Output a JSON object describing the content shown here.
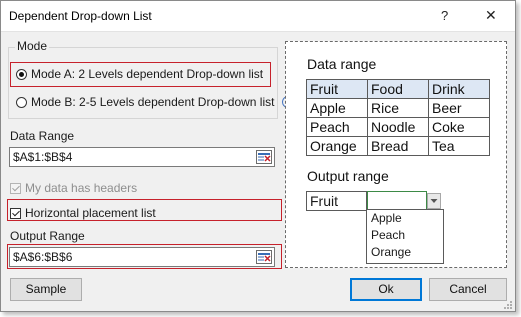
{
  "window": {
    "title": "Dependent Drop-down List",
    "help_glyph": "?",
    "close_glyph": "✕"
  },
  "mode": {
    "group_label": "Mode",
    "option_a": "Mode A: 2 Levels dependent Drop-down list",
    "option_b": "Mode B: 2-5 Levels dependent Drop-down list",
    "selected": "option_a",
    "info_glyph": "i"
  },
  "data_range": {
    "label": "Data Range",
    "value": "$A$1:$B$4"
  },
  "headers": {
    "label": "My data has headers",
    "checked": true,
    "enabled": false
  },
  "horizontal": {
    "label": "Horizontal placement list",
    "checked": true
  },
  "output_range": {
    "label": "Output Range",
    "value": "$A$6:$B$6"
  },
  "preview": {
    "data_heading": "Data range",
    "table": [
      [
        "Fruit",
        "Food",
        "Drink"
      ],
      [
        "Apple",
        "Rice",
        "Beer"
      ],
      [
        "Peach",
        "Noodle",
        "Coke"
      ],
      [
        "Orange",
        "Bread",
        "Tea"
      ]
    ],
    "output_heading": "Output range",
    "output_cell": "Fruit",
    "dropdown_options": [
      "Apple",
      "Peach",
      "Orange"
    ]
  },
  "buttons": {
    "sample": "Sample",
    "ok": "Ok",
    "cancel": "Cancel"
  },
  "colors": {
    "highlight_border": "#c6212b",
    "selection_border": "#3d8a46",
    "header_fill": "#dde7f4"
  }
}
